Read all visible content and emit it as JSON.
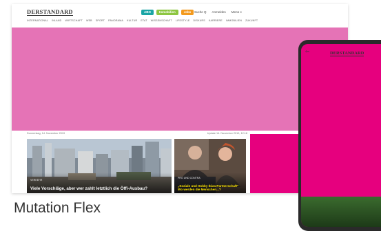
{
  "desktop": {
    "logo": "DERSTANDARD",
    "pills": [
      {
        "label": "ABO",
        "color": "#1aa5a5"
      },
      {
        "label": "Immobilien",
        "color": "#8dc641"
      },
      {
        "label": "Jobs",
        "color": "#f39a1e"
      }
    ],
    "header_links": [
      "Suche Q",
      "Anmelden",
      "Menü ≡"
    ],
    "nav": [
      "International",
      "Inland",
      "Wirtschaft",
      "Web",
      "Sport",
      "Panorama",
      "Kultur",
      "Etat",
      "Wissenschaft",
      "Lifestyle",
      "Diskurs",
      "Karriere",
      "Immobilien",
      "Zukunft"
    ],
    "date_left": "Donnerstag, 14. November 2019",
    "date_right": "Update 14. November 2019, 12:18",
    "articles": [
      {
        "kicker": "Verkehr",
        "headline": "Viele Vorschläge, aber wer zahlt letztlich die Öffi-Ausbau?"
      },
      {
        "kicker": "Pro und Contra",
        "headline": "„Soziale und Hobby Ibiza-Partnerschaft\" Wo werden die Menschen...?"
      }
    ]
  },
  "caption": "Mutation Flex",
  "phone": {
    "logo": "DERSTANDARD",
    "arrow": "⇦"
  }
}
